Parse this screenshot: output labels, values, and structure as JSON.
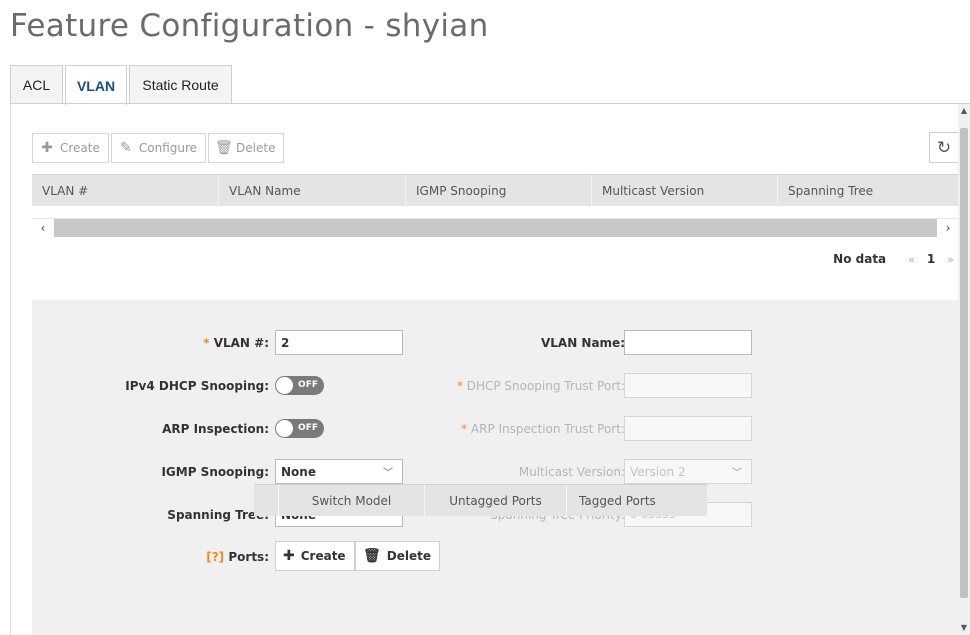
{
  "page": {
    "title": "Feature Configuration - shyian"
  },
  "tabs": [
    {
      "label": "ACL"
    },
    {
      "label": "VLAN"
    },
    {
      "label": "Static Route"
    }
  ],
  "active_tab": "VLAN",
  "toolbar": {
    "create_label": "Create",
    "configure_label": "Configure",
    "delete_label": "Delete"
  },
  "icons": {
    "create": "plus-icon",
    "configure": "pencil-icon",
    "delete": "trash-icon",
    "refresh": "refresh-icon",
    "scroll_left": "chevron-left-icon",
    "scroll_right": "chevron-right-icon"
  },
  "grid": {
    "columns": [
      "VLAN #",
      "VLAN Name",
      "IGMP Snooping",
      "Multicast Version",
      "Spanning Tree"
    ],
    "rows": []
  },
  "pagination": {
    "status": "No data",
    "prev": "«",
    "current": "1",
    "next": "»"
  },
  "form": {
    "vlan_id": {
      "label": "VLAN #:",
      "required_mark": "*",
      "value": "2"
    },
    "vlan_name": {
      "label": "VLAN Name:",
      "value": ""
    },
    "ipv4_dhcp_snooping": {
      "label": "IPv4 DHCP Snooping:",
      "state": "OFF"
    },
    "dhcp_trust_port": {
      "label": "DHCP Snooping Trust Port:",
      "required_mark": "*",
      "value": ""
    },
    "arp_inspection": {
      "label": "ARP Inspection:",
      "state": "OFF"
    },
    "arp_trust_port": {
      "label": "ARP Inspection Trust Port:",
      "required_mark": "*",
      "value": ""
    },
    "igmp_snooping": {
      "label": "IGMP Snooping:",
      "value": "None"
    },
    "multicast_version": {
      "label": "Multicast Version:",
      "value": "Version 2"
    },
    "spanning_tree": {
      "label": "Spanning Tree:",
      "value": "None"
    },
    "spanning_tree_priority": {
      "label": "Spanning Tree Priority:",
      "placeholder": "0-65535"
    },
    "ports": {
      "label": "Ports:",
      "help_mark": "[?]",
      "create_label": "Create",
      "delete_label": "Delete",
      "columns": [
        "Switch Model",
        "Untagged Ports",
        "Tagged Ports"
      ]
    }
  },
  "colors": {
    "accent": "#1a4f80",
    "required": "#f08a24",
    "toggle_off": "#7a7a7a",
    "panel": "#f0f0f0"
  }
}
